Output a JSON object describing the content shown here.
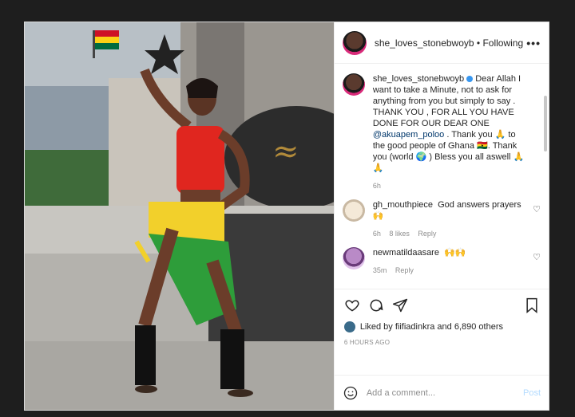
{
  "header": {
    "username": "she_loves_stonebwoyb",
    "follow_state": "Following",
    "more": "•••"
  },
  "caption": {
    "username": "she_loves_stonebwoyb",
    "text_1": "Dear Allah I want to take a Minute, not to ask for anything from you but simply to say . THANK YOU , FOR ALL YOU HAVE DONE FOR OUR DEAR ONE",
    "mention": "@akuapem_poloo",
    "text_2": ". Thank you 🙏 to the good people of Ghana 🇬🇭. Thank you (world 🌍 ) Bless you all aswell 🙏🙏",
    "age": "6h"
  },
  "comments": [
    {
      "username": "gh_mouthpiece",
      "text": "God answers prayers 🙌",
      "age": "6h",
      "likes": "8 likes",
      "reply": "Reply"
    },
    {
      "username": "newmatildaasare",
      "text": "🙌🙌",
      "age": "35m",
      "reply": "Reply"
    }
  ],
  "post": {
    "liked_by_user": "fiifiadinkra",
    "likes_text": "Liked by fiifiadinkra and 6,890 others",
    "time_ago": "6 HOURS AGO"
  },
  "comment_box": {
    "placeholder": "Add a comment...",
    "post_label": "Post"
  },
  "icons": [
    "heart-icon",
    "comment-icon",
    "share-icon",
    "bookmark-icon",
    "emoji-icon",
    "more-icon",
    "verified-icon"
  ],
  "colors": {
    "link": "#00376b",
    "post_button": "#b3dbff",
    "verified": "#3897f0"
  }
}
